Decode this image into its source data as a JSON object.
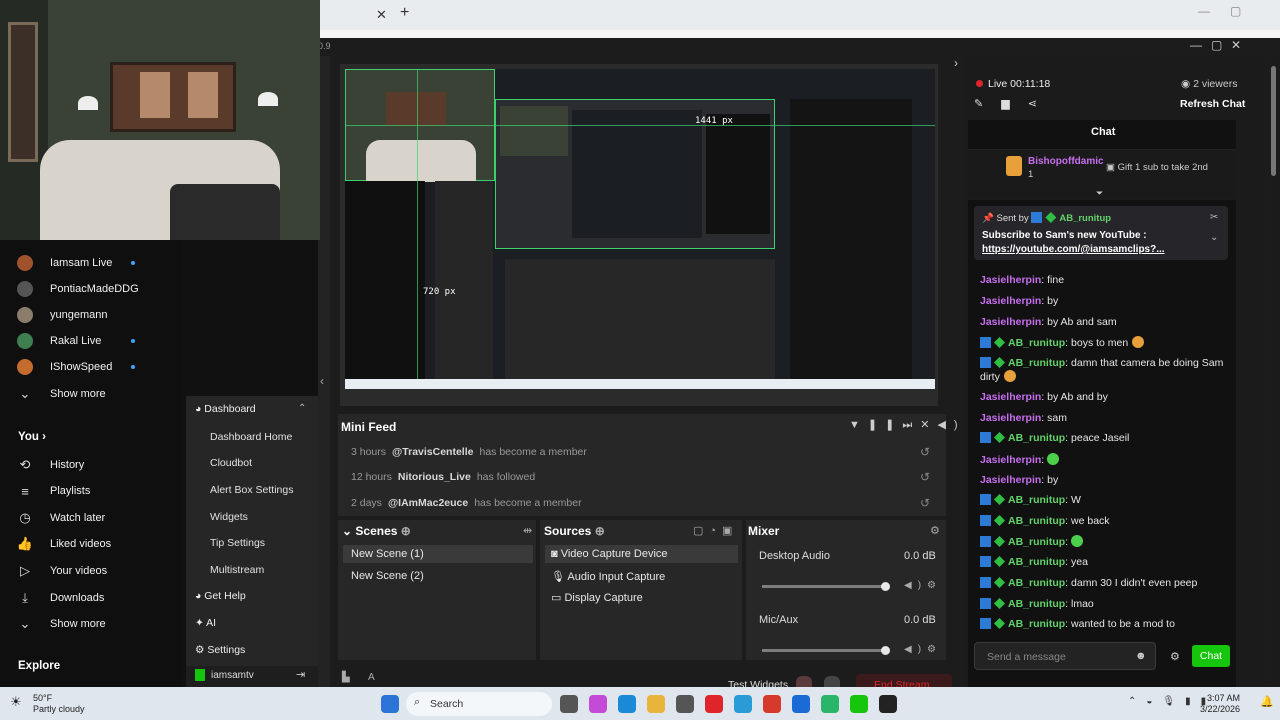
{
  "browser": {
    "close_tab": "✕",
    "new_tab": "+"
  },
  "obs": {
    "version_frag": "0.9"
  },
  "preview": {
    "px_label_w": "1441 px",
    "px_label_h": "720 px"
  },
  "youtube": {
    "subs": [
      {
        "name": "Iamsam Live",
        "live": true,
        "color": "#a0522d"
      },
      {
        "name": "PontiacMadeDDG",
        "live": false,
        "color": "#555"
      },
      {
        "name": "yungemann",
        "live": false,
        "color": "#8b7d6b"
      },
      {
        "name": "Rakal Live",
        "live": true,
        "color": "#3f7f4f"
      },
      {
        "name": "IShowSpeed",
        "live": true,
        "color": "#c46b2d"
      }
    ],
    "show_more_1": "Show more",
    "you": "You",
    "you_chev": "›",
    "you_items": [
      "History",
      "Playlists",
      "Watch later",
      "Liked videos",
      "Your videos",
      "Downloads"
    ],
    "show_more_2": "Show more",
    "explore": "Explore"
  },
  "streamelements": {
    "dashboard": "Dashboard",
    "items": [
      "Dashboard Home",
      "Cloudbot",
      "Alert Box Settings",
      "Widgets",
      "Tip Settings",
      "Multistream"
    ],
    "get_help": "Get Help",
    "ai": "AI",
    "settings": "Settings",
    "account": "iamsamtv"
  },
  "minifeed": {
    "title": "Mini Feed",
    "rows": [
      {
        "time": "3 hours",
        "user": "@TravisCentelle",
        "event": "has become a member"
      },
      {
        "time": "12 hours",
        "user": "Nitorious_Live",
        "event": "has followed"
      },
      {
        "time": "2 days",
        "user": "@IAmMac2euce",
        "event": "has become a member"
      }
    ]
  },
  "scenes": {
    "title": "Scenes",
    "items": [
      "New Scene (1)",
      "New Scene (2)"
    ]
  },
  "sources": {
    "title": "Sources",
    "items": [
      "Video Capture Device",
      "Audio Input Capture",
      "Display Capture"
    ]
  },
  "mixer": {
    "title": "Mixer",
    "channels": [
      {
        "name": "Desktop Audio",
        "db": "0.0 dB",
        "level": 1.0
      },
      {
        "name": "Mic/Aux",
        "db": "0.0 dB",
        "level": 1.0
      }
    ]
  },
  "bottom": {
    "test_widgets": "Test Widgets",
    "end_stream": "End Stream"
  },
  "chat": {
    "live": "Live 00:11:18",
    "viewers": "2 viewers",
    "refresh": "Refresh Chat",
    "title": "Chat",
    "gifter": "Bishopoffdamic",
    "gifter_count": "1",
    "gift_text": "Gift 1 sub to take 2nd",
    "pinned_by": "Sent by",
    "pinned_user": "AB_runitup",
    "pinned_text": "Subscribe to Sam's new YouTube :",
    "pinned_link": "https://youtube.com/@iamsamclips?...",
    "messages": [
      {
        "user": "Jasielherpin",
        "text": "fine",
        "type": "pink"
      },
      {
        "user": "Jasielherpin",
        "text": "by",
        "type": "pink"
      },
      {
        "user": "Jasielherpin",
        "text": "by Ab and sam",
        "type": "pink"
      },
      {
        "user": "AB_runitup",
        "text": "boys to men",
        "type": "green"
      },
      {
        "user": "AB_runitup",
        "text": "damn that camera be doing Sam dirty",
        "type": "green"
      },
      {
        "user": "Jasielherpin",
        "text": "by Ab and by",
        "type": "pink"
      },
      {
        "user": "Jasielherpin",
        "text": "sam",
        "type": "pink"
      },
      {
        "user": "AB_runitup",
        "text": "peace Jaseil",
        "type": "green"
      },
      {
        "user": "Jasielherpin",
        "text": "",
        "type": "pink"
      },
      {
        "user": "Jasielherpin",
        "text": "by",
        "type": "pink"
      },
      {
        "user": "AB_runitup",
        "text": "W",
        "type": "green"
      },
      {
        "user": "AB_runitup",
        "text": "we back",
        "type": "green"
      },
      {
        "user": "AB_runitup",
        "text": "",
        "type": "green"
      },
      {
        "user": "AB_runitup",
        "text": "yea",
        "type": "green"
      },
      {
        "user": "AB_runitup",
        "text": "damn 30 I didn't even peep",
        "type": "green"
      },
      {
        "user": "AB_runitup",
        "text": "lmao",
        "type": "green"
      },
      {
        "user": "AB_runitup",
        "text": "wanted to be a mod to",
        "type": "green"
      }
    ],
    "input_placeholder": "Send a message",
    "send": "Chat"
  },
  "taskbar": {
    "temp": "50°F",
    "weather": "Partly cloudy",
    "search": "Search",
    "time": "3:07 AM",
    "date": "3/22/2026"
  },
  "colors": {
    "accent_green": "#16c60c",
    "end_stream_red": "#e0242b",
    "live_red": "#e0242b"
  }
}
